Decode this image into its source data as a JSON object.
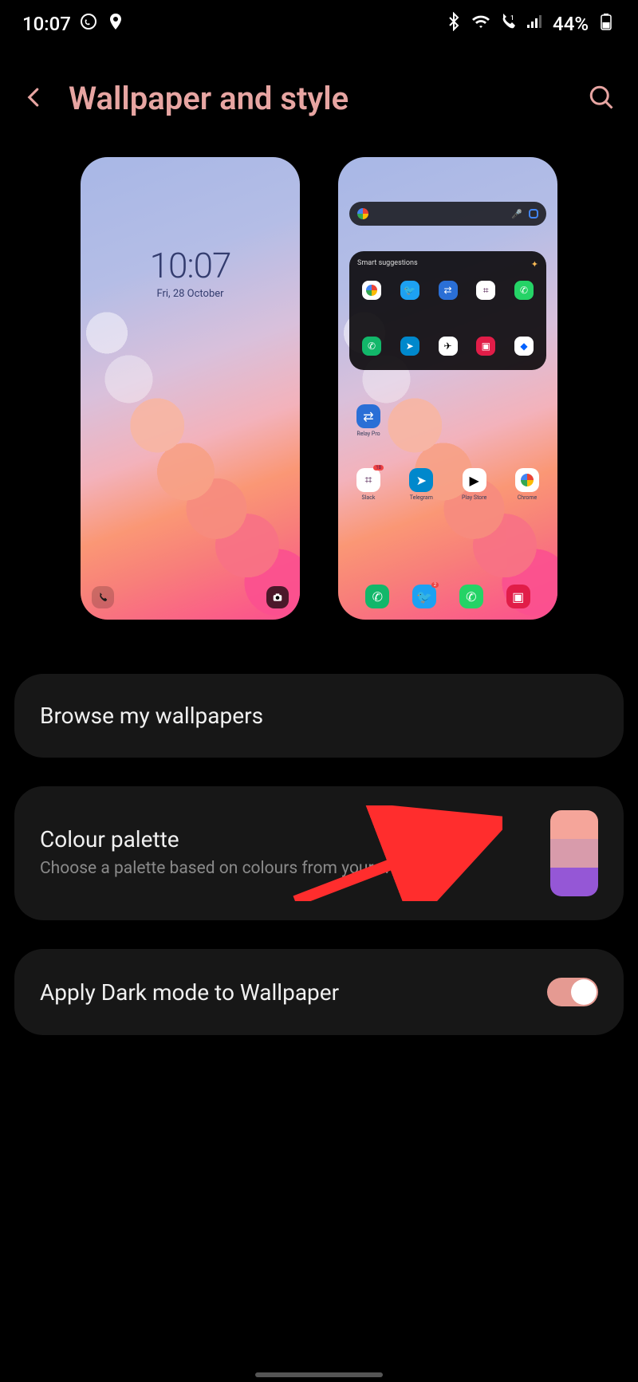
{
  "status": {
    "time": "10:07",
    "battery": "44%"
  },
  "header": {
    "title": "Wallpaper and style"
  },
  "lockscreen": {
    "time": "10:07",
    "date": "Fri, 28 October"
  },
  "homescreen": {
    "widget_title": "Smart suggestions",
    "single_app": "Relay Pro",
    "apps_row": [
      "Slack",
      "Telegram",
      "Play Store",
      "Chrome"
    ]
  },
  "items": {
    "browse": {
      "title": "Browse my wallpapers"
    },
    "palette": {
      "title": "Colour palette",
      "sub": "Choose a palette based on colours from your wallpaper."
    },
    "dark": {
      "title": "Apply Dark mode to Wallpaper",
      "enabled": true
    }
  },
  "palette_colors": [
    "#f5a59a",
    "#d89bab",
    "#9557d6"
  ]
}
